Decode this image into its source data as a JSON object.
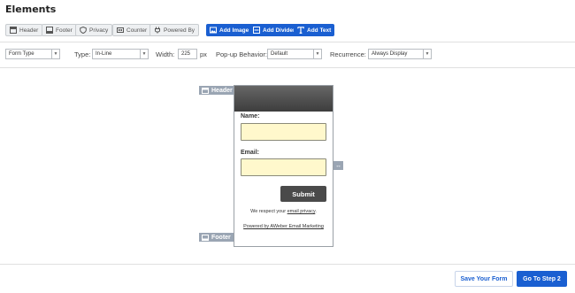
{
  "title": "Elements",
  "elements": {
    "header": "Header",
    "footer": "Footer",
    "privacy": "Privacy",
    "counter": "Counter",
    "powered_by": "Powered By",
    "add_image": "Add Image",
    "add_divider": "Add Divider",
    "add_text": "Add Text"
  },
  "options": {
    "form_type": "Form Type",
    "type_label": "Type:",
    "type_value": "In-Line",
    "width_label": "Width:",
    "width_value": "225",
    "width_unit": "px",
    "popup_label": "Pop-up Behavior:",
    "popup_value": "Default",
    "recurrence_label": "Recurrence:",
    "recurrence_value": "Always Display"
  },
  "canvas": {
    "header_tag": "Header",
    "footer_tag": "Footer",
    "name_label": "Name:",
    "email_label": "Email:",
    "submit_label": "Submit",
    "privacy_prefix": "We respect your ",
    "privacy_link": "email privacy",
    "privacy_suffix": ".",
    "powered_text": "Powered by AWeber Email Marketing"
  },
  "footer": {
    "save_label": "Save Your Form",
    "step_label": "Go To Step 2"
  },
  "colors": {
    "accent": "#1a5fd1",
    "input_bg": "#fff8cc",
    "tag_bg": "#9aa5b3"
  }
}
